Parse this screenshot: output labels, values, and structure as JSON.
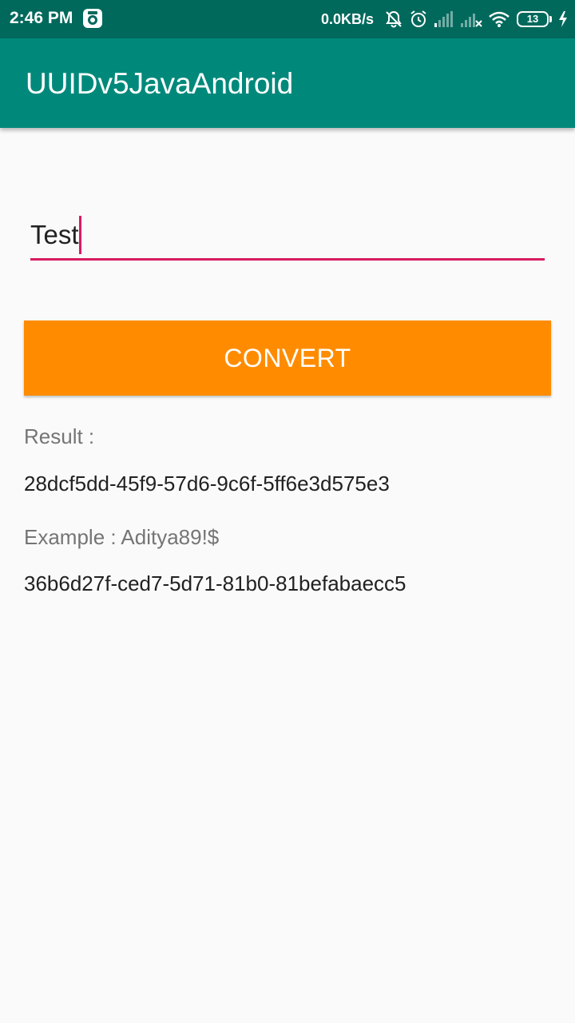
{
  "status_bar": {
    "time": "2:46 PM",
    "network_speed": "0.0KB/s",
    "battery_level": "13",
    "icons": [
      "camera-icon",
      "mute-icon",
      "alarm-icon",
      "signal-icon",
      "signal-x-icon",
      "wifi-icon",
      "battery-icon",
      "charging-icon"
    ]
  },
  "app_bar": {
    "title": "UUIDv5JavaAndroid"
  },
  "input": {
    "value": "Test"
  },
  "convert_button": {
    "label": "CONVERT"
  },
  "result": {
    "label": "Result :",
    "value": "28dcf5dd-45f9-57d6-9c6f-5ff6e3d575e3"
  },
  "example": {
    "label": "Example : Aditya89!$",
    "value": "36b6d27f-ced7-5d71-81b0-81befabaecc5"
  },
  "colors": {
    "status_bar": "#00695c",
    "app_bar": "#00897b",
    "accent": "#d81b60",
    "button": "#ff8c00",
    "background": "#fafafa"
  }
}
